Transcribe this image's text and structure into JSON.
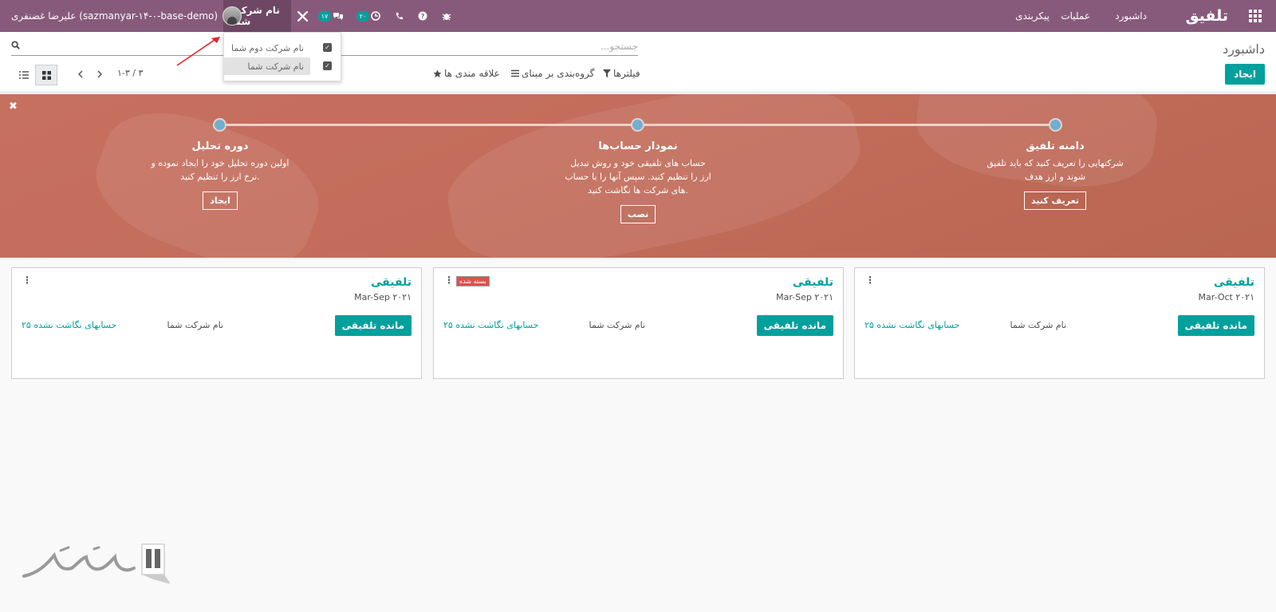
{
  "navbar": {
    "brand": "تلفیق",
    "menu": [
      "داشبورد",
      "عملیات",
      "پیکربندی"
    ],
    "company_switch": "نام شرکت شما",
    "activity_badge": "۲۰",
    "messages_badge": "۱۷",
    "user": "علیرضا غضنفری (sazmanyar-۱۴-۰-base-demo)"
  },
  "company_dropdown": {
    "items": [
      {
        "label": "نام شرکت دوم شما",
        "checked": true
      },
      {
        "label": "نام شرکت شما",
        "checked": true
      }
    ]
  },
  "control_panel": {
    "title": "داشبورد",
    "create_label": "ایجاد",
    "search_placeholder": "جستجو...",
    "filters_label": "فیلترها",
    "groupby_label": "گروه‌بندی بر مبنای",
    "favorites_label": "علاقه مندی ها",
    "pager": "۱-۳ / ۳"
  },
  "banner": {
    "steps": [
      {
        "title": "دامنه تلفیق",
        "desc": [
          "شرکتهایی را تعریف کنید که باید تلفیق",
          "شوند و ارز هدف"
        ],
        "button": "تعریف کنید"
      },
      {
        "title": "نمودار حساب‌ها",
        "desc": [
          "حساب های تلفیقی خود و روش تبدیل",
          "ارز را تنظیم کنید. سپس آنها را با حساب",
          "های شرکت ها نگاشت کنید."
        ],
        "button": "نصب"
      },
      {
        "title": "دوره تحلیل",
        "desc": [
          "اولین دوره تحلیل خود را ایجاد نموده و",
          "نرخ ارز را تنظیم کنید."
        ],
        "button": "ایجاد"
      }
    ]
  },
  "cards": [
    {
      "title": "تلفیقی",
      "date": "Mar-Oct ۲۰۲۱",
      "button": "مانده تلفیقی",
      "company": "نام شرکت شما",
      "link": "۲۵ حسابهای نگاشت نشده",
      "tag": ""
    },
    {
      "title": "تلفیقی",
      "date": "Mar-Sep ۲۰۲۱",
      "button": "مانده تلفیقی",
      "company": "نام شرکت شما",
      "link": "۲۵ حسابهای نگاشت نشده",
      "tag": "بسته شده"
    },
    {
      "title": "تلفیقی",
      "date": "Mar-Sep ۲۰۲۱",
      "button": "مانده تلفیقی",
      "company": "نام شرکت شما",
      "link": "۲۵ حسابهای نگاشت نشده",
      "tag": ""
    }
  ],
  "watermark": {
    "text": "سازمان‌یار"
  },
  "colors": {
    "navbar": "#875a7b",
    "accent": "#00a09d",
    "banner": "#c46d5c",
    "dot": "#6fafd0"
  }
}
